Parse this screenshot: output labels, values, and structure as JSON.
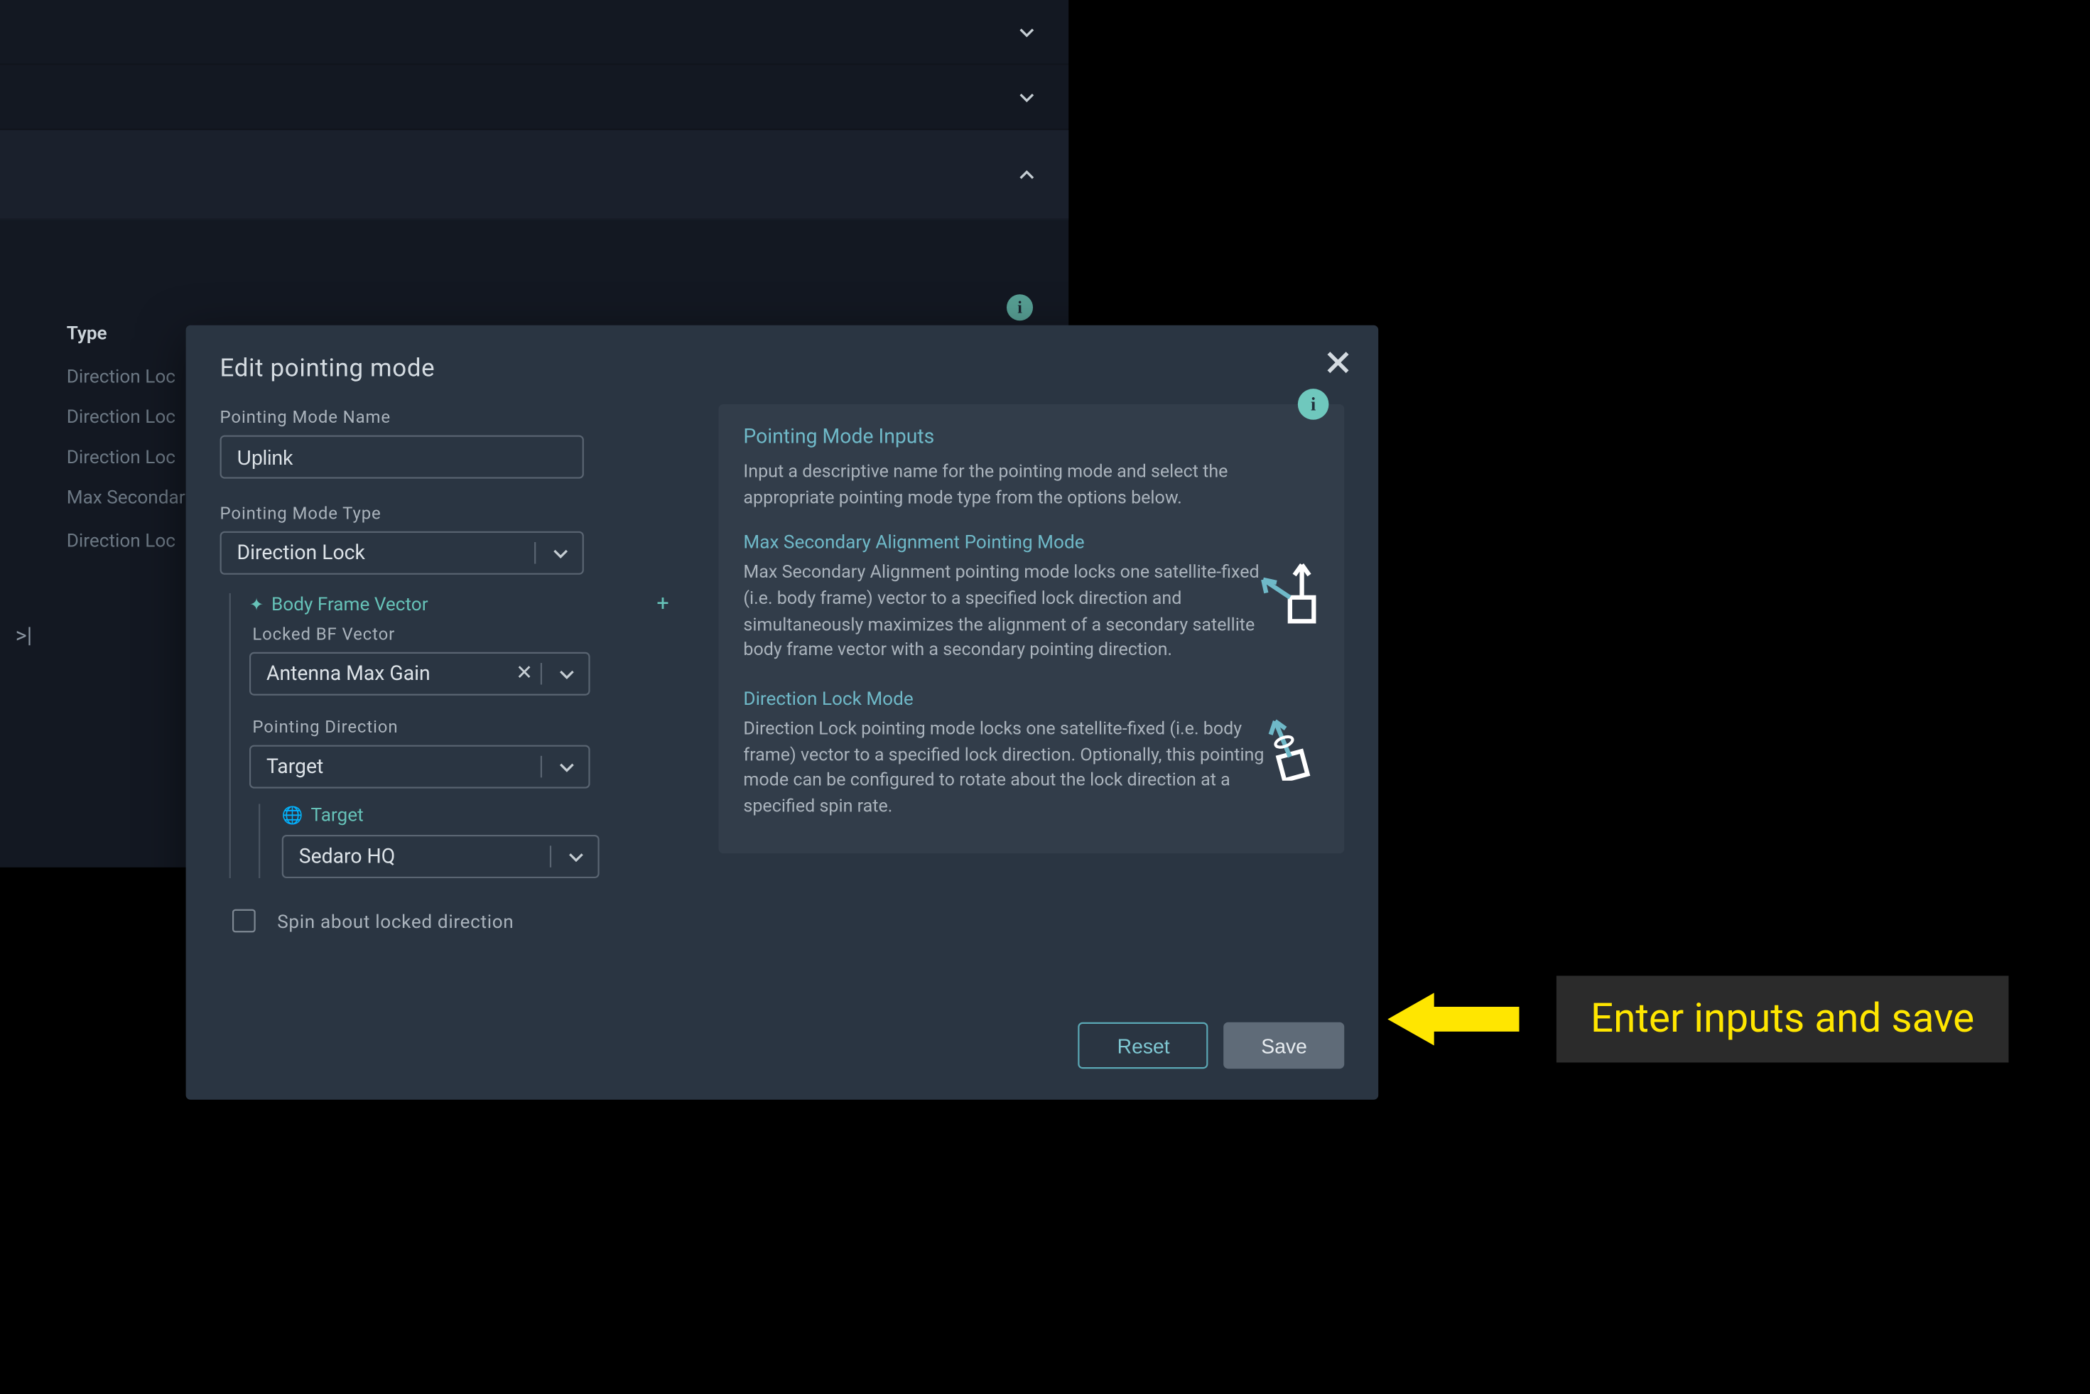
{
  "bg": {
    "header": "Type",
    "rows": [
      "Direction Loc",
      "Direction Loc",
      "Direction Loc",
      "Max Secondary Alignment",
      "Direction Loc"
    ],
    "nav_glyph": ">|"
  },
  "modal": {
    "title": "Edit pointing mode",
    "name_label": "Pointing Mode Name",
    "name_value": "Uplink",
    "type_label": "Pointing Mode Type",
    "type_value": "Direction Lock",
    "body_frame_vector_label": "Body Frame Vector",
    "locked_bf_label": "Locked BF Vector",
    "locked_bf_value": "Antenna Max Gain",
    "pointing_dir_label": "Pointing Direction",
    "pointing_dir_value": "Target",
    "target_label": "Target",
    "target_value": "Sedaro HQ",
    "spin_label": "Spin about locked direction",
    "reset": "Reset",
    "save": "Save"
  },
  "help": {
    "h1": "Pointing Mode Inputs",
    "p1": "Input a descriptive name for the pointing mode and select the appropriate pointing mode type from the options below.",
    "h2a": "Max Secondary Alignment Pointing Mode",
    "p2a": "Max Secondary Alignment pointing mode locks one satellite-fixed (i.e. body frame) vector to a specified lock direction and simultaneously maximizes the alignment of a secondary satellite body frame vector with a secondary pointing direction.",
    "h2b": "Direction Lock Mode",
    "p2b": "Direction Lock pointing mode locks one satellite-fixed (i.e. body frame) vector to a specified lock direction. Optionally, this pointing mode can be configured to rotate about the lock direction at a specified spin rate."
  },
  "callout": "Enter inputs and save"
}
